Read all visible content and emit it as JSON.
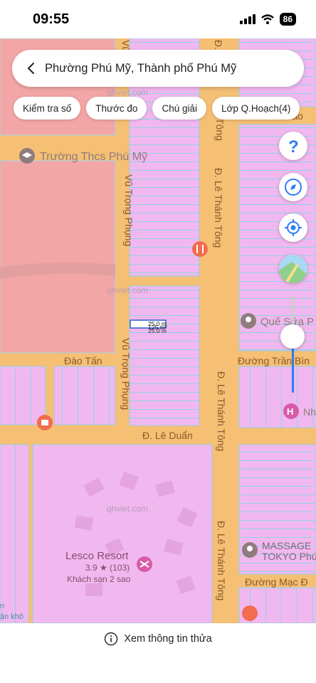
{
  "status_bar": {
    "time": "09:55",
    "battery": "86"
  },
  "search": {
    "text": "Phường Phú Mỹ, Thành phố Phú Mỹ"
  },
  "chips": [
    {
      "label": "Kiểm tra số"
    },
    {
      "label": "Thước đo"
    },
    {
      "label": "Chú giải"
    },
    {
      "label": "Lớp Q.Hoạch(4)"
    }
  ],
  "map": {
    "watermark": "qhviet.com",
    "streets": {
      "vu_trong_phung": "Vũ Trọng Phụng",
      "le_thanh_tong": "Đ. Lê Thánh Tông",
      "dao_tan": "Đào Tấn",
      "le_duan": "Đ. Lê Duẩn",
      "tran_binh": "Đường Trần Bìn",
      "mac_dinh": "Đường Mạc Đ",
      "vu_top": "Vũ",
      "d_top": "Đ.",
      "tong_top": "Tông",
      "tran_cao": "Trần Cao"
    },
    "pois": {
      "school": "Trường Thcs Phú Mỹ",
      "que_sua": "Quế Sữa P",
      "nh": "Nh",
      "resort_name": "Lesco Resort",
      "resort_rating": "3.9 ★ (103)",
      "resort_type": "Khách sạn 2 sao",
      "massage_1": "MASSAGE",
      "massage_2": "TOKYO Phú",
      "kho": "ận khô",
      "n_edge": "n"
    },
    "measure": {
      "line1": "25.0 m",
      "line2": "125 m²",
      "line3": "25.0 m"
    }
  },
  "bottom": {
    "info_label": "Xem thông tin thửa"
  },
  "colors": {
    "road": "#f5bf74",
    "parcel": "#f1b8ef",
    "residential": "#f3a6a6",
    "accent": "#2f7cf6"
  }
}
